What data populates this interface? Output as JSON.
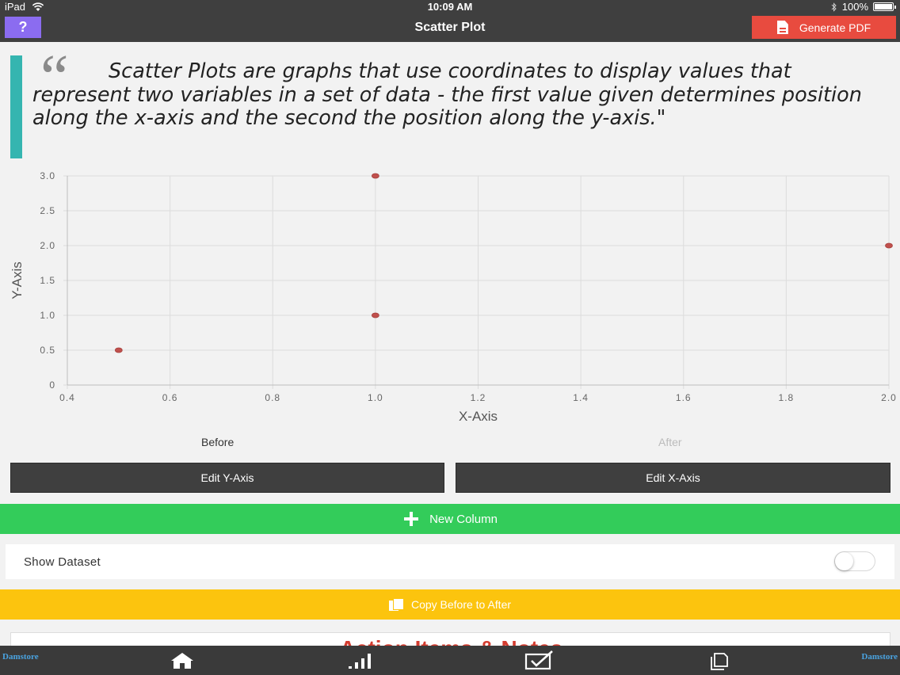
{
  "status_bar": {
    "carrier": "iPad",
    "time": "10:09 AM",
    "battery": "100%"
  },
  "nav": {
    "help_label": "?",
    "title": "Scatter Plot",
    "pdf_label": "Generate PDF"
  },
  "quote": {
    "mark": "“",
    "text": "Scatter Plots are graphs that use coordinates to display values that represent two variables in a set of data - the first value given determines position along the x-axis and the second the position along the y-axis.\""
  },
  "chart_data": {
    "type": "scatter",
    "series": [
      {
        "points": [
          {
            "x": 0.5,
            "y": 0.5
          },
          {
            "x": 1.0,
            "y": 3.0
          },
          {
            "x": 1.0,
            "y": 1.0
          },
          {
            "x": 2.0,
            "y": 2.0
          }
        ]
      }
    ],
    "xlabel": "X-Axis",
    "ylabel": "Y-Axis",
    "xlim": [
      0.4,
      2.0
    ],
    "ylim": [
      0,
      3.0
    ],
    "x_ticks": [
      "0.4",
      "0.6",
      "0.8",
      "1.0",
      "1.2",
      "1.4",
      "1.6",
      "1.8",
      "2.0"
    ],
    "y_ticks": [
      "0",
      "0.5",
      "1.0",
      "1.5",
      "2.0",
      "2.5",
      "3.0"
    ],
    "grid": true,
    "point_color": "#c0504d"
  },
  "legend": {
    "before": "Before",
    "after": "After"
  },
  "buttons": {
    "edit_y": "Edit Y-Axis",
    "edit_x": "Edit X-Axis",
    "new_column": "New Column",
    "copy": "Copy Before to After"
  },
  "dataset": {
    "label": "Show Dataset",
    "toggle_on": false
  },
  "notes": {
    "title": "Action Items & Notes"
  },
  "tabs": [
    "home-icon",
    "bar-chart-icon",
    "checkbox-icon",
    "pages-icon"
  ],
  "brand": "Damstore"
}
